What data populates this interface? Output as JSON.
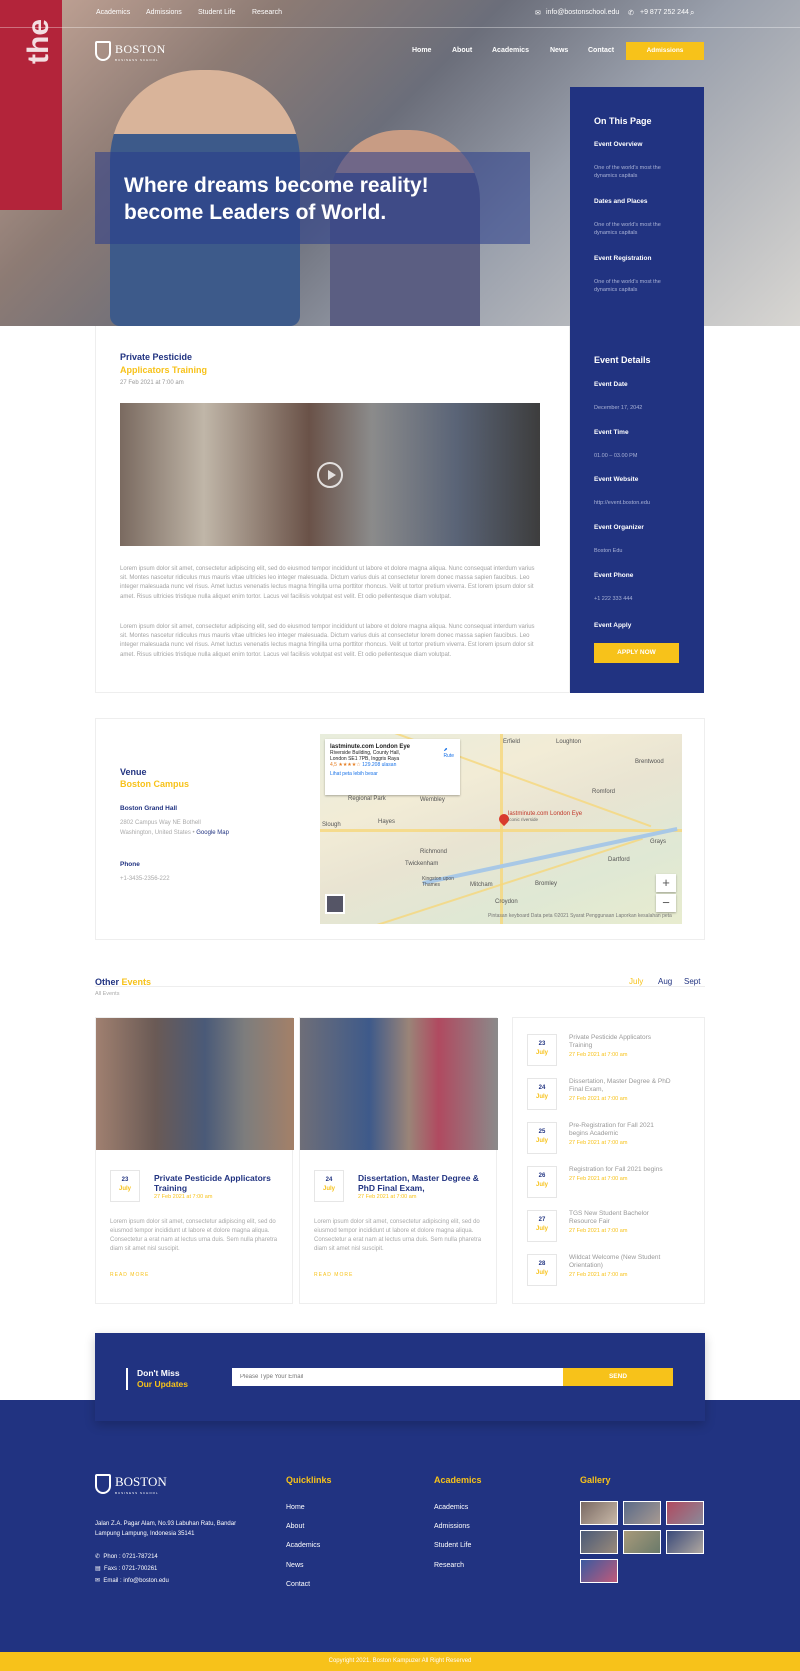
{
  "topbar": {
    "links": [
      "Academics",
      "Admissions",
      "Student Life",
      "Research"
    ],
    "email": "info@bostonschool.edu",
    "phone": "+9 877 252 244"
  },
  "nav": {
    "logo": "BOSTON",
    "logo_sub": "BUSINESS SCHOOL",
    "items": [
      "Home",
      "About",
      "Academics",
      "News",
      "Contact"
    ],
    "cta": "Admissions"
  },
  "hero": {
    "wall_text": "the",
    "headline_1": "Where dreams become reality!",
    "headline_2": "become Leaders of World."
  },
  "sidebar": {
    "title": "On This Page",
    "items": [
      {
        "title": "Event Overview",
        "desc": "One of the world's most the dynamics capitals"
      },
      {
        "title": "Dates and Places",
        "desc": "One of the world's most the dynamics capitals"
      },
      {
        "title": "Event Registration",
        "desc": "One of the world's most the dynamics capitals"
      }
    ],
    "details_title": "Event Details",
    "details": [
      {
        "label": "Event Date",
        "value": "December 17, 2042"
      },
      {
        "label": "Event Time",
        "value": "01.00 – 03.00 PM"
      },
      {
        "label": "Event Website",
        "value": "http://event.boston.edu"
      },
      {
        "label": "Event Organizer",
        "value": "Boston Edu"
      },
      {
        "label": "Event Phone",
        "value": "+1 222 333 444"
      }
    ],
    "apply_title": "Event Apply",
    "apply_button": "APPLY NOW"
  },
  "article": {
    "title_1": "Private Pesticide",
    "title_2": "Applicators Training",
    "date": "27 Feb 2021 at 7:00 am",
    "para_1": "Lorem ipsum dolor sit amet, consectetur adipiscing elit, sed do eiusmod tempor incididunt ut labore et dolore magna aliqua. Nunc consequat interdum varius sit. Montes nascetur ridiculus mus mauris vitae ultricies leo integer malesuada. Dictum varius duis at consectetur lorem donec massa sapien faucibus. Leo integer malesuada nunc vel risus. Amet luctus venenatis lectus magna fringilla urna porttitor rhoncus. Velit ut tortor pretium viverra. Est lorem ipsum dolor sit amet. Risus ultricies tristique nulla aliquet enim tortor. Lacus vel facilisis volutpat est velit. Et odio pellentesque diam volutpat.",
    "para_2": "Lorem ipsum dolor sit amet, consectetur adipiscing elit, sed do eiusmod tempor incididunt ut labore et dolore magna aliqua. Nunc consequat interdum varius sit. Montes nascetur ridiculus mus mauris vitae ultricies leo integer malesuada. Dictum varius duis at consectetur lorem donec massa sapien faucibus. Leo integer malesuada nunc vel risus. Amet luctus venenatis lectus magna fringilla urna porttitor rhoncus. Velit ut tortor pretium viverra. Est lorem ipsum dolor sit amet. Risus ultricies tristique nulla aliquet enim tortor. Lacus vel facilisis volutpat est velit. Et odio pellentesque diam volutpat."
  },
  "venue": {
    "label": "Venue",
    "name": "Boston Campus",
    "hall": "Boston Grand Hall",
    "address_1": "2802 Campus Way NE Bothell",
    "address_2": "Washington, United States •",
    "map_link": "Google Map",
    "phone_label": "Phone",
    "phone": "+1-3435-2356-222"
  },
  "map": {
    "place": "lastminute.com London Eye",
    "address_1": "Riverside Building, County Hall,",
    "address_2": "London SE1 7PB, Inggris Raya",
    "rating": "4,5 ★★★★☆",
    "reviews": "129.208 ulasan",
    "route": "Rute",
    "larger": "Lihat peta lebih besar",
    "pin_label": "lastminute.com London Eye",
    "pin_sub": "Iconic riverside",
    "places": [
      "Erfield",
      "Loughton",
      "Brentwood",
      "Wembley",
      "Romford",
      "Slough",
      "Hayes",
      "Richmond",
      "Twickenham",
      "Kingston upon Thames",
      "Mitcham",
      "Croydon",
      "Bromley",
      "Dartford",
      "Grays",
      "Regional Park"
    ],
    "footer": "Pintasan keyboard   Data peta ©2021   Syarat Penggunaan   Laporkan kesalahan peta",
    "zoom_in": "+",
    "zoom_out": "−"
  },
  "other": {
    "title_1": "Other",
    "title_2": "Events",
    "sub": "All Events",
    "months": [
      "July",
      "Aug",
      "Sept"
    ],
    "cards": [
      {
        "day": "23",
        "month": "July",
        "title": "Private Pesticide Applicators Training",
        "date": "27 Feb 2021 at 7:00 am",
        "text": "Lorem ipsum dolor sit amet, consectetur adipiscing elit, sed do eiusmod tempor incididunt ut labore et dolore magna aliqua. Consectetur a erat nam at lectus urna duis. Sem nulla pharetra diam sit amet nisl suscipit.",
        "more": "READ MORE"
      },
      {
        "day": "24",
        "month": "July",
        "title": "Dissertation, Master Degree & PhD Final Exam,",
        "date": "27 Feb 2021 at 7:00 am",
        "text": "Lorem ipsum dolor sit amet, consectetur adipiscing elit, sed do eiusmod tempor incididunt ut labore et dolore magna aliqua. Consectetur a erat nam at lectus urna duis. Sem nulla pharetra diam sit amet nisl suscipit.",
        "more": "READ MORE"
      }
    ],
    "list": [
      {
        "day": "23",
        "month": "July",
        "title": "Private Pesticide Applicators Training",
        "date": "27 Feb 2021 at 7:00 am"
      },
      {
        "day": "24",
        "month": "July",
        "title": "Dissertation, Master Degree & PhD Final Exam,",
        "date": "27 Feb 2021 at 7:00 am"
      },
      {
        "day": "25",
        "month": "July",
        "title": "Pre-Registration for Fall 2021 begins Academic",
        "date": "27 Feb 2021 at 7:00 am"
      },
      {
        "day": "26",
        "month": "July",
        "title": "Registration for Fall 2021 begins",
        "date": "27 Feb 2021 at 7:00 am"
      },
      {
        "day": "27",
        "month": "July",
        "title": "TGS New Student Bachelor Resource Fair",
        "date": "27 Feb 2021 at 7:00 am"
      },
      {
        "day": "28",
        "month": "July",
        "title": "Wildcat Welcome (New Student Orientation)",
        "date": "27 Feb 2021 at 7:00 am"
      }
    ]
  },
  "subscribe": {
    "title_1": "Don't Miss",
    "title_2": "Our Updates",
    "placeholder": "Please Type Your Email",
    "button": "SEND"
  },
  "footer": {
    "logo": "BOSTON",
    "logo_sub": "BUSINESS SCHOOL",
    "address": "Jalan Z.A. Pagar Alam, No.93 Labuhan Ratu, Bandar Lampung Lampung, Indonesia 35141",
    "phone": "Phon : 0721-787214",
    "fax": "Faxs : 0721-700261",
    "email": "Email : info@boston.edu",
    "quicklinks_title": "Quicklinks",
    "quicklinks": [
      "Home",
      "About",
      "Academics",
      "News",
      "Contact"
    ],
    "academics_title": "Academics",
    "academics": [
      "Academics",
      "Admissions",
      "Student Life",
      "Research"
    ],
    "gallery_title": "Gallery",
    "copyright": "Copyright 2021. Boston Kampuzer All Right Reserved"
  },
  "colors": {
    "primary": "#213381",
    "accent": "#f7c21a"
  }
}
